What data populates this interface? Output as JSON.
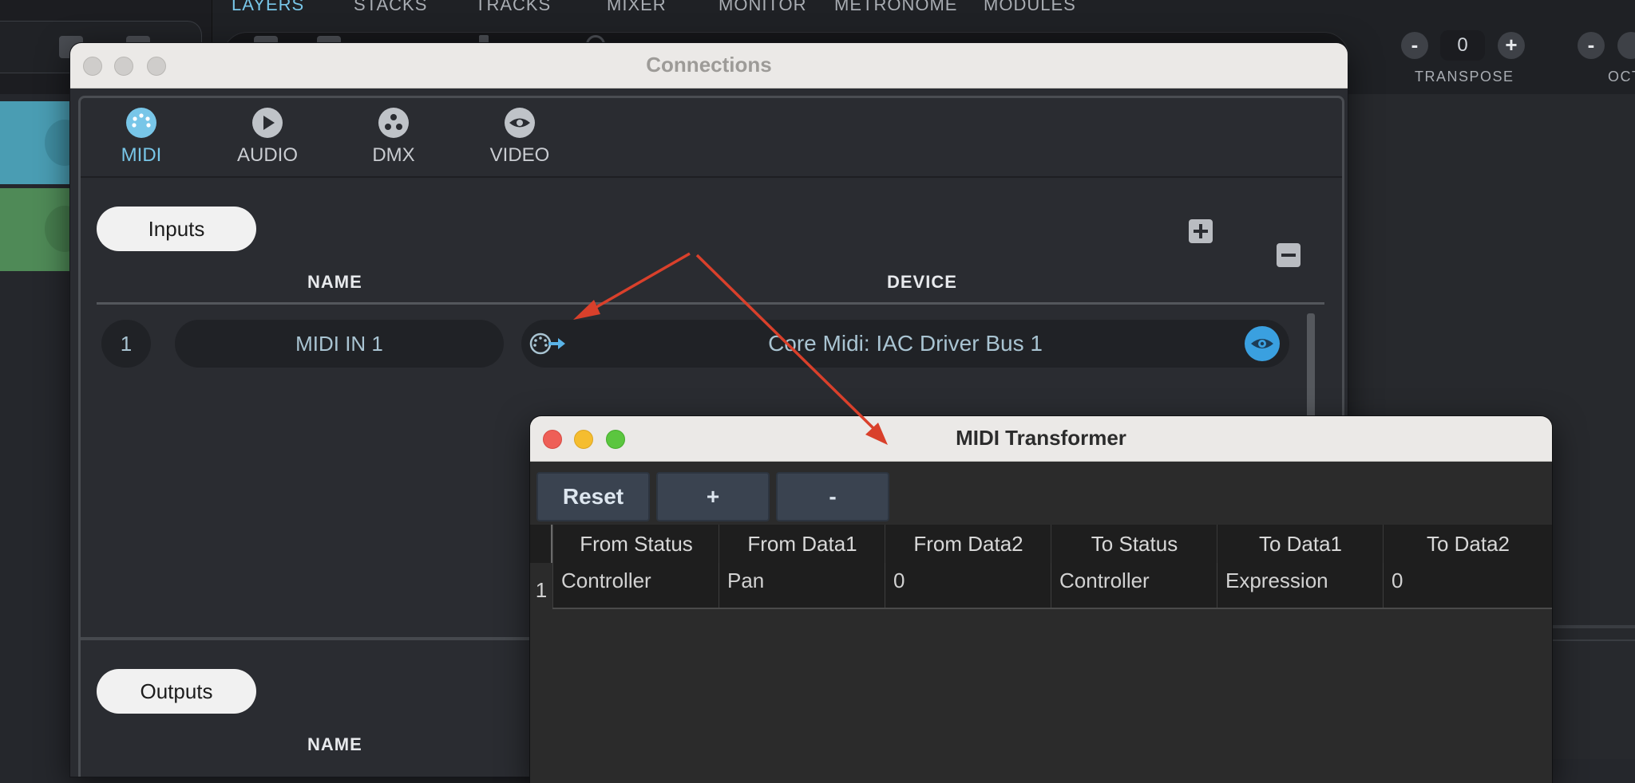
{
  "background_app": {
    "tabs": [
      "LAYERS",
      "STACKS",
      "TRACKS",
      "MIXER",
      "MONITOR",
      "METRONOME",
      "MODULES"
    ],
    "active_tab": "LAYERS",
    "transpose": {
      "minus": "-",
      "value": "0",
      "plus": "+",
      "label": "TRANSPOSE"
    },
    "octave": {
      "minus": "-",
      "label": "OCT"
    }
  },
  "connections": {
    "title": "Connections",
    "tabs": [
      {
        "label": "MIDI",
        "icon": "midi-connector-icon"
      },
      {
        "label": "AUDIO",
        "icon": "play-icon"
      },
      {
        "label": "DMX",
        "icon": "dmx-icon"
      },
      {
        "label": "VIDEO",
        "icon": "eye-icon"
      }
    ],
    "active_tab": "MIDI",
    "inputs": {
      "button_label": "Inputs",
      "columns": {
        "name": "NAME",
        "device": "DEVICE"
      },
      "rows": [
        {
          "index": "1",
          "name": "MIDI IN 1",
          "device": "Core Midi: IAC Driver Bus 1"
        }
      ]
    },
    "outputs": {
      "button_label": "Outputs",
      "columns": {
        "name": "NAME"
      }
    }
  },
  "midi_transformer": {
    "title": "MIDI Transformer",
    "buttons": {
      "reset": "Reset",
      "add": "+",
      "remove": "-"
    },
    "columns": [
      "From Status",
      "From Data1",
      "From Data2",
      "To Status",
      "To Data1",
      "To Data2"
    ],
    "rows": [
      {
        "index": "1",
        "cells": [
          "Controller",
          "Pan",
          "0",
          "Controller",
          "Expression",
          "0"
        ]
      }
    ]
  },
  "colors": {
    "accent": "#78c6e8",
    "annotation_arrow": "#d9402b",
    "eye_button": "#3aa0e0"
  }
}
